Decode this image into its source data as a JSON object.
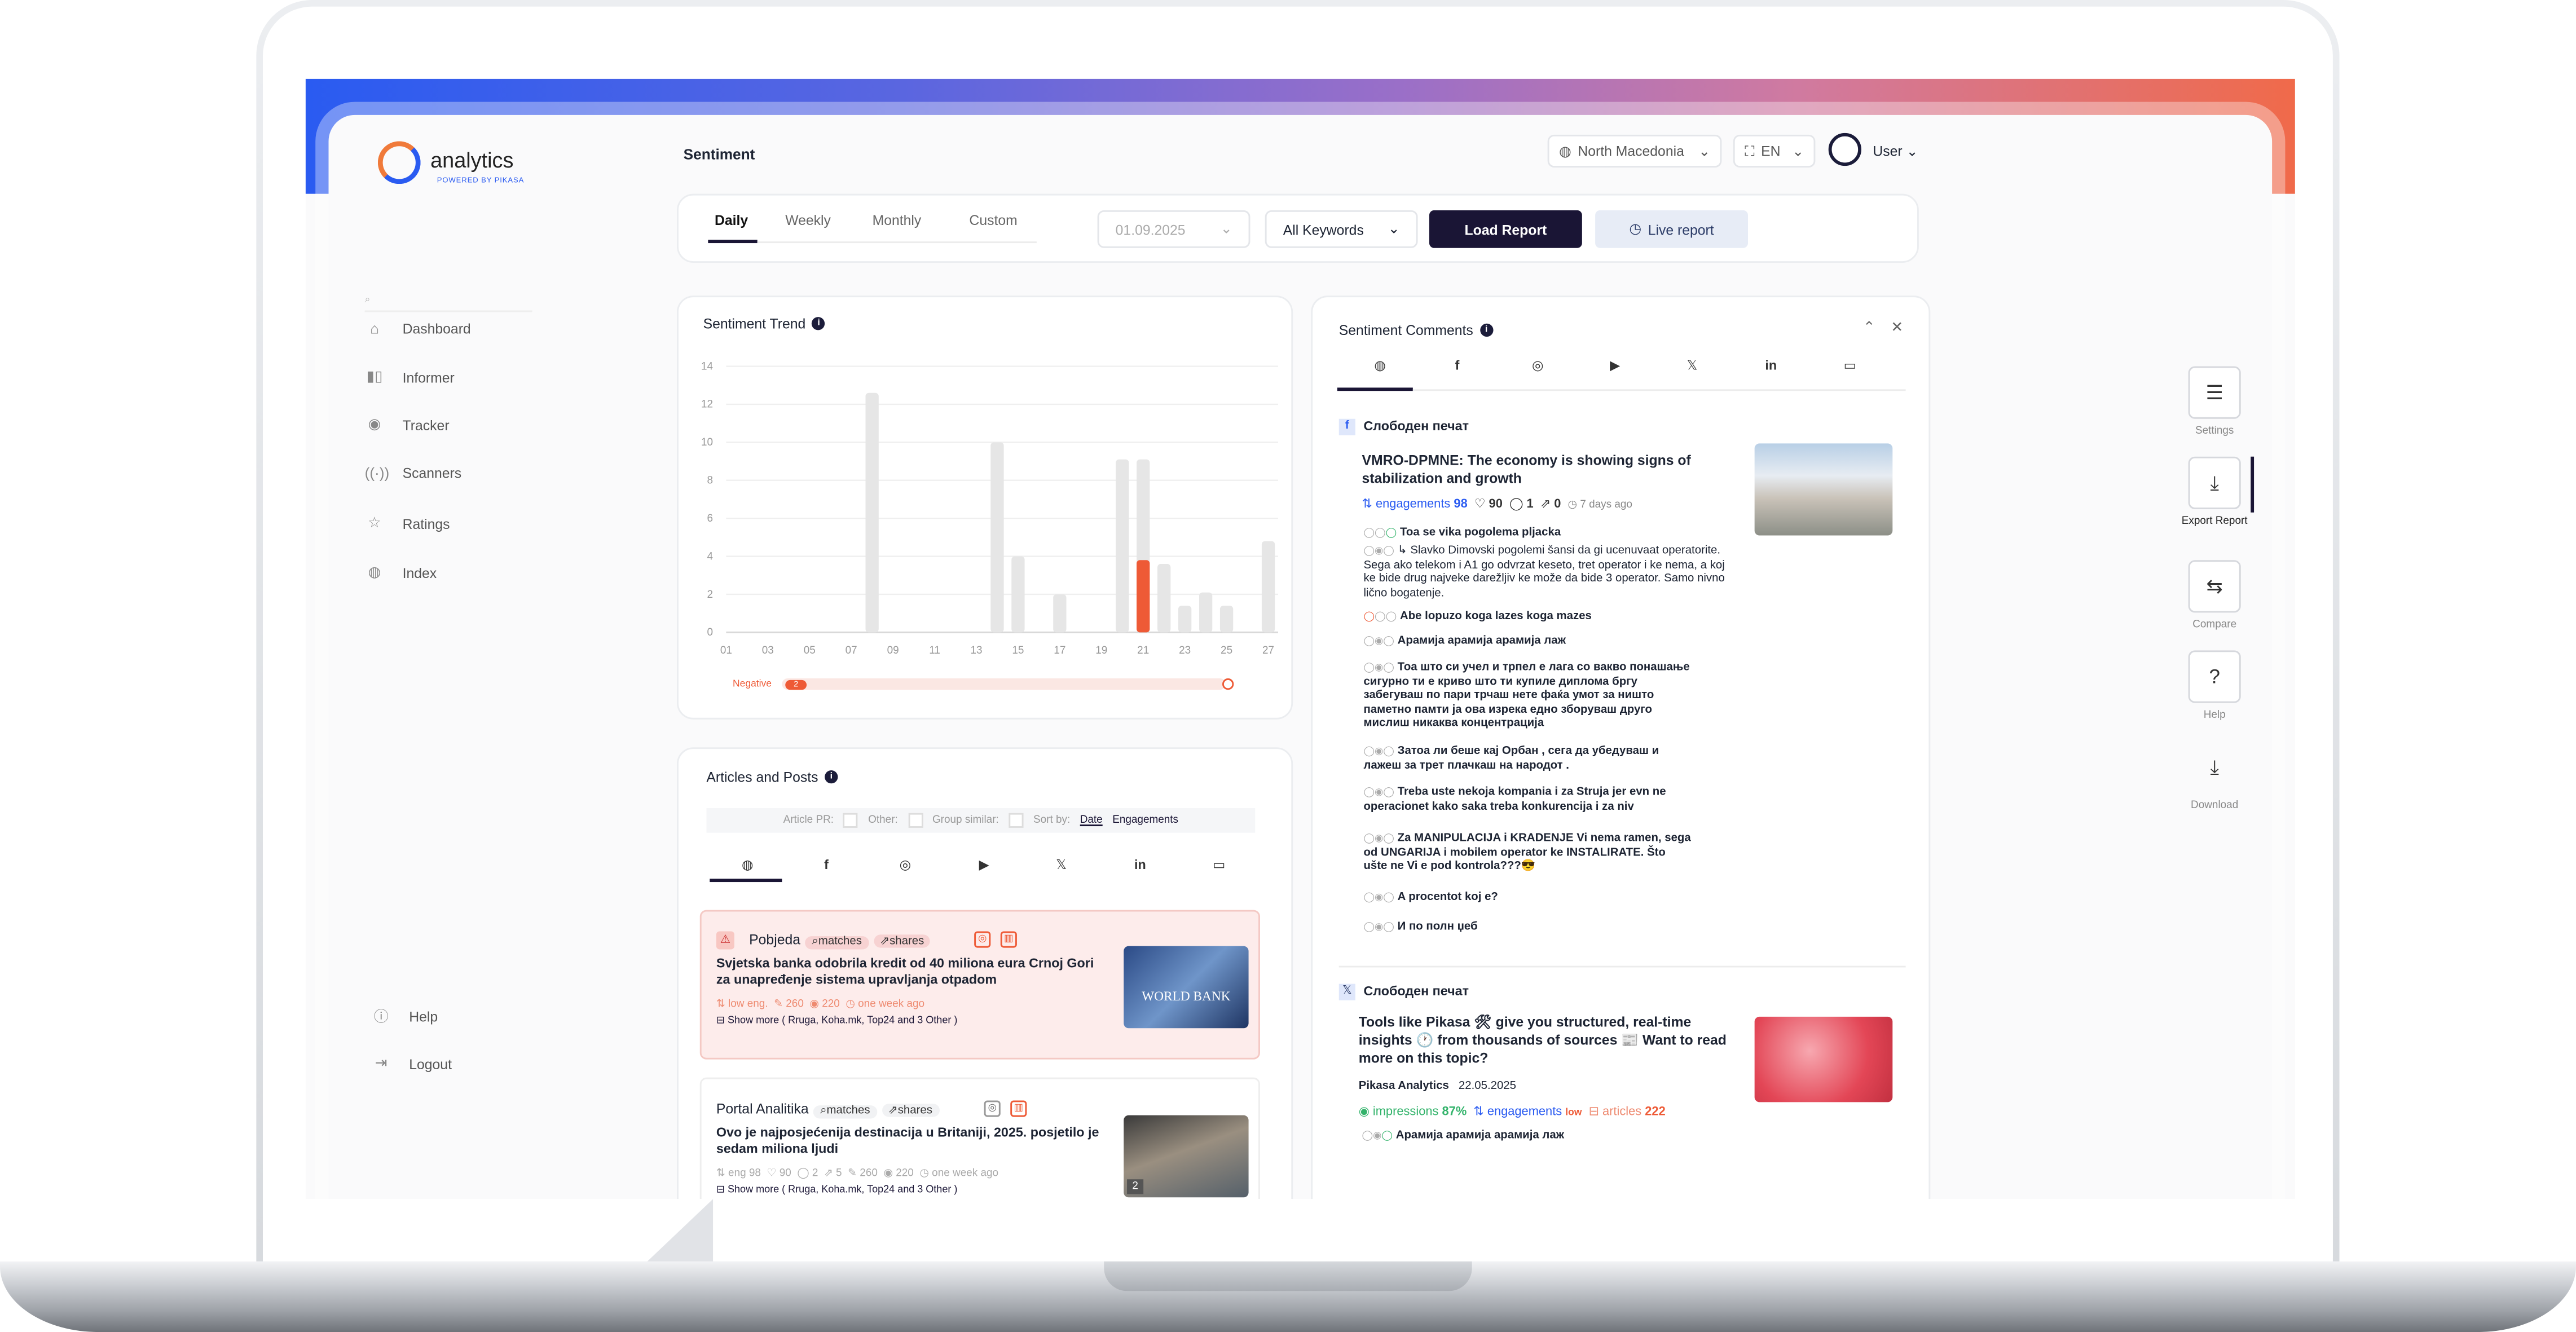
{
  "app": {
    "logo": "analytics",
    "logo_sub": "POWERED BY PIKASA",
    "page_title": "Sentiment"
  },
  "topbar": {
    "country": "North Macedonia",
    "language": "EN",
    "user": "User"
  },
  "sidebar": {
    "items": [
      {
        "label": "Dashboard",
        "icon": "home-icon"
      },
      {
        "label": "Informer",
        "icon": "bars-icon"
      },
      {
        "label": "Tracker",
        "icon": "tracker-icon"
      },
      {
        "label": "Scanners",
        "icon": "scanner-icon"
      },
      {
        "label": "Ratings",
        "icon": "star-icon"
      },
      {
        "label": "Index",
        "icon": "globe-icon"
      }
    ],
    "help": "Help",
    "logout": "Logout"
  },
  "filters": {
    "tabs": [
      "Daily",
      "Weekly",
      "Monthly",
      "Custom"
    ],
    "active_tab": "Daily",
    "date": "01.09.2025",
    "keywords": "All Keywords",
    "load_button": "Load Report",
    "live_button": "Live  report"
  },
  "trend": {
    "title": "Sentiment Trend",
    "legend_label": "Negative",
    "legend_count": "2"
  },
  "chart_data": {
    "type": "bar",
    "categories": [
      "01",
      "02",
      "03",
      "04",
      "05",
      "06",
      "07",
      "08",
      "09",
      "10",
      "11",
      "12",
      "13",
      "14",
      "15",
      "16",
      "17",
      "18",
      "19",
      "20",
      "21",
      "22",
      "23",
      "24",
      "25",
      "26",
      "27"
    ],
    "x_tick_labels": [
      "01",
      "03",
      "05",
      "07",
      "09",
      "11",
      "13",
      "15",
      "17",
      "19",
      "21",
      "23",
      "25",
      "27"
    ],
    "series": [
      {
        "name": "total",
        "values": [
          0,
          0,
          0,
          0,
          0,
          0,
          0,
          12.6,
          0,
          0,
          0,
          0,
          0,
          10,
          4,
          0,
          2,
          0,
          0,
          9.1,
          9.1,
          3.6,
          1.4,
          2.1,
          1.4,
          0,
          4.8
        ],
        "color": "#e6e6e6"
      },
      {
        "name": "Negative",
        "values": [
          0,
          0,
          0,
          0,
          0,
          0,
          0,
          0,
          0,
          0,
          0,
          0,
          0,
          0,
          0,
          0,
          0,
          0,
          0,
          0,
          3.8,
          0,
          0,
          0,
          0,
          0,
          0
        ],
        "color": "#ee5a36"
      }
    ],
    "y_ticks": [
      0,
      2,
      4,
      6,
      8,
      10,
      12,
      14
    ],
    "ylim": [
      0,
      14
    ],
    "grid": true
  },
  "articles": {
    "title": "Articles and Posts",
    "filter_bar": {
      "article_pr": "Article PR:",
      "other": "Other:",
      "group_similar": "Group similar:",
      "sort_by": "Sort by:",
      "sort_date": "Date",
      "sort_engagements": "Engagements"
    },
    "items": [
      {
        "source": "Pobjeda",
        "tag1": "matches",
        "tag2": "shares",
        "title": "Svjetska banka odobrila kredit od 40 miliona eura Crnoj Gori za unapređenje sistema upravljanja otpadom",
        "meta_eng": "low eng.",
        "meta_a": "260",
        "meta_b": "220",
        "meta_time": "one week ago",
        "more": "Show more ( Rruga, Koha.mk, Top24 and 3 Other )",
        "thumb_label": "WORLD BANK"
      },
      {
        "source": "Portal Analitika",
        "tag1": "matches",
        "tag2": "shares",
        "title": "Ovo je najposjećenija destinacija u Britaniji, 2025. posjetilo je sedam miliona ljudi",
        "meta_eng": "eng 98",
        "meta_a": "90",
        "meta_b": "2",
        "meta_c": "5",
        "meta_d": "260",
        "meta_e": "220",
        "meta_time": "one week ago",
        "more": "Show more ( Rruga, Koha.mk, Top24 and 3 Other )",
        "thumb_badge": "2"
      }
    ]
  },
  "comments": {
    "title": "Sentiment Comments",
    "post1": {
      "source": "Слободен печат",
      "title": "VMRO-DPMNE: The economy is showing signs of stabilization and growth",
      "engagements_label": "engagements",
      "engagements": "98",
      "likes": "90",
      "comments": "1",
      "shares": "0",
      "time": "7 days ago",
      "items": [
        "Toa se vika pogolema pljacka",
        "↳ Slavko Dimovski pogolemi šansi da gi ucenuvaat operatorite. Sega ako telekom i A1 go odvrzat keseto, tret operator i ke nema, a koj ke bide drug najveke darežljiv ke može da bide 3 operator. Samo nivno lično bogatenje.",
        "Abe lopuzo koga lazes koga mazes",
        "Арамија арамија арамија лаж",
        "Тоа што си учел и трпел е лага со вакво понашање сигурно ти е криво што ти купиле диплома бргу забегуваш по пари трчаш нете фаќа умот за ништо паметно памти ја ова изрека едно зборуваш друго мислиш никаква концентрација",
        "Затоа ли беше кај Орбан , сега да убедуваш и лажеш за трет плачкаш на народот .",
        "Treba uste nekoja kompania i za Struja jer evn ne operacionet kako saka treba konkurencija i za niv",
        "Za MANIPULACIJA i KRADENJE Vi nema ramen, sega od UNGARIJA i mobilem operator ke INSTALIRATE. Što ušte ne Vi e pod kontrola???😎",
        "A procentot koj e?",
        "И по полн џеб"
      ]
    },
    "post2": {
      "source": "Слободен печат",
      "title": "Tools like Pikasa 🛠 give you structured, real-time insights 🕐 from thousands of sources 📰 Want to read more on this topic?",
      "author": "Pikasa Analytics",
      "date": "22.05.2025",
      "impressions_label": "impressions",
      "impressions": "87%",
      "engagements_label": "engagements",
      "engagements": "low",
      "articles_label": "articles",
      "articles": "222",
      "items": [
        "Арамија арамија арамија лаж"
      ]
    }
  },
  "tools": [
    {
      "label": "Settings",
      "icon": "sliders-icon"
    },
    {
      "label": "Export Report",
      "icon": "file-download-icon"
    },
    {
      "label": "Compare",
      "icon": "compare-icon"
    },
    {
      "label": "Help",
      "icon": "question-icon"
    },
    {
      "label": "Download",
      "icon": "download-icon"
    }
  ],
  "colors": {
    "accent": "#2a5bf1",
    "dark": "#1a1535",
    "negative": "#ee5a36",
    "positive": "#33b36b"
  }
}
